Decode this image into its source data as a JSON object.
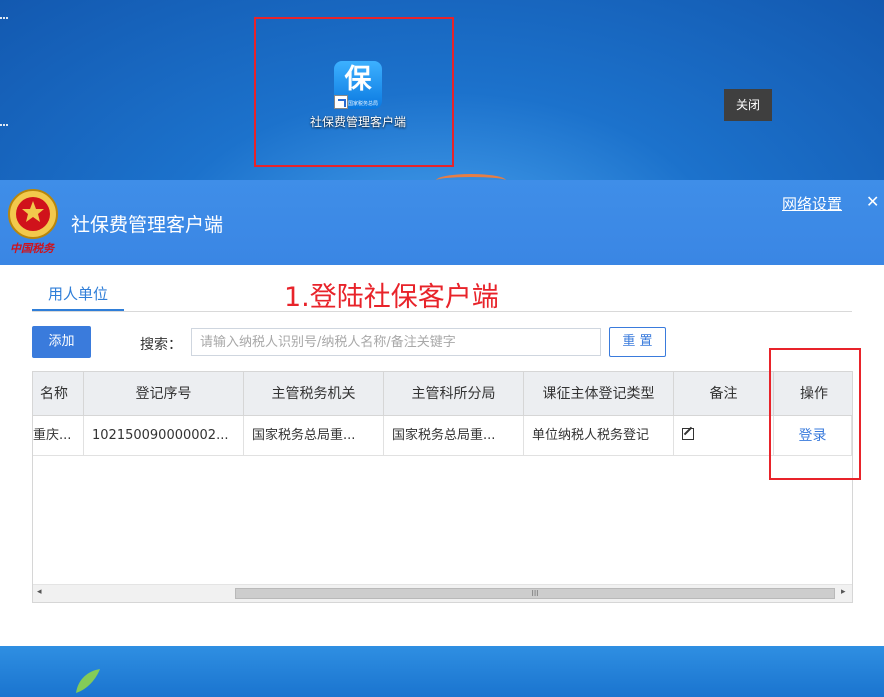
{
  "desktop": {
    "icon_label": "社保费管理客户端",
    "icon_glyph": "保",
    "icon_subtext": "国家税务总局",
    "tooltip_close": "关闭"
  },
  "window": {
    "title": "社保费管理客户端",
    "emblem_caption": "中国税务",
    "network_settings": "网络设置",
    "close_glyph": "✕",
    "tab": "用人单位",
    "annotation": "1.登陆社保客户端",
    "add_button": "添加",
    "search_label": "搜索：",
    "search_placeholder": "请输入纳税人识别号/纳税人名称/备注关键字",
    "reset_button": "重 置",
    "table": {
      "headers": [
        "名称",
        "登记序号",
        "主管税务机关",
        "主管科所分局",
        "课征主体登记类型",
        "备注",
        "操作"
      ],
      "rows": [
        {
          "name": "重庆...",
          "reg_no": "102150090000002...",
          "tax_office": "国家税务总局重...",
          "branch": "国家税务总局重...",
          "reg_type": "单位纳税人税务登记",
          "action": "登录"
        }
      ]
    },
    "scroll_left": "◂",
    "scroll_right": "▸",
    "scroll_grip": "III"
  },
  "colors": {
    "accent": "#3a7bdc",
    "header": "#3f8ee8",
    "annotation": "#e8232a"
  }
}
